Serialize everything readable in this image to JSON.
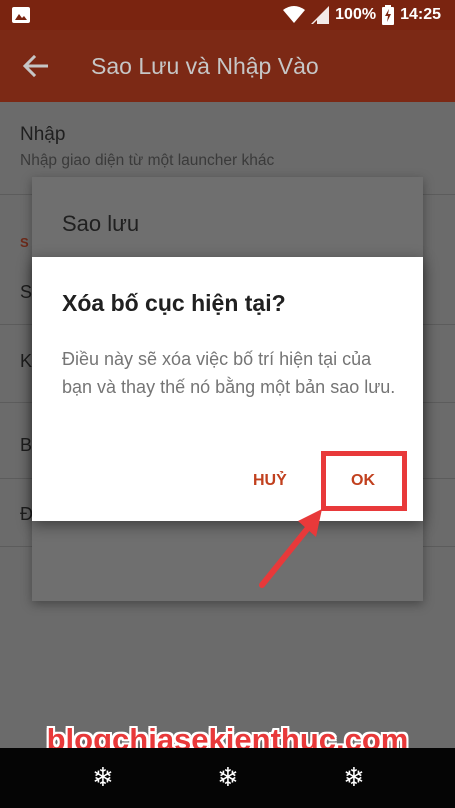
{
  "status_bar": {
    "battery": "100%",
    "time": "14:25",
    "icons": [
      "image-icon",
      "wifi-icon",
      "signal-icon",
      "battery-charging-icon"
    ]
  },
  "app_bar": {
    "title": "Sao Lưu và Nhập Vào",
    "back_icon": "back-arrow-icon"
  },
  "settings": {
    "import_title": "Nhập",
    "import_subtitle": "Nhập giao diện từ một launcher khác",
    "peek_letters": [
      "S",
      "S",
      "K",
      "B",
      "Đ"
    ]
  },
  "backup_dialog": {
    "title": "Sao lưu"
  },
  "confirm_dialog": {
    "title": "Xóa bố cục hiện tại?",
    "message": "Điều này sẽ xóa việc bố trí hiện tại của bạn và thay thế nó bằng một bản sao lưu.",
    "cancel_label": "HUỶ",
    "ok_label": "OK"
  },
  "annotation": {
    "highlight_color": "#e8393a"
  },
  "watermark": {
    "text": "blogchiasekienthuc.com"
  },
  "nav_bar": {
    "icons": [
      "snowflake-icon",
      "snowflake-icon",
      "snowflake-icon"
    ]
  },
  "colors": {
    "app_bar": "#7c2915",
    "accent": "#c1401e"
  }
}
